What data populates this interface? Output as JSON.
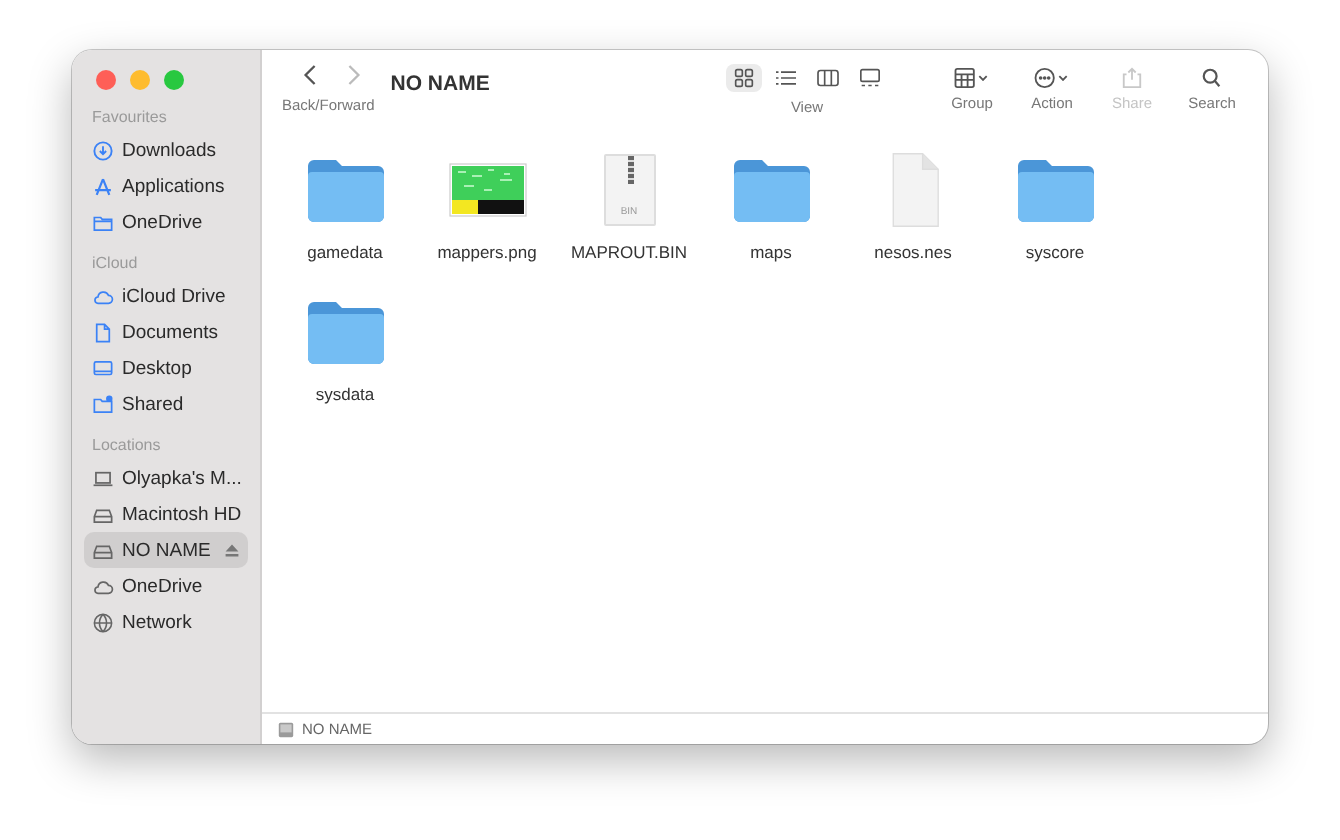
{
  "window": {
    "title": "NO NAME"
  },
  "toolbar": {
    "nav_label": "Back/Forward",
    "view_buttons": [
      {
        "kind": "icons",
        "selected": true
      },
      {
        "kind": "list",
        "selected": false
      },
      {
        "kind": "columns",
        "selected": false
      },
      {
        "kind": "gallery",
        "selected": false
      }
    ],
    "view_label": "View",
    "actions": [
      {
        "kind": "group",
        "label": "Group",
        "disabled": false
      },
      {
        "kind": "action",
        "label": "Action",
        "disabled": false
      },
      {
        "kind": "share",
        "label": "Share",
        "disabled": true
      },
      {
        "kind": "search",
        "label": "Search",
        "disabled": false
      }
    ]
  },
  "sidebar": {
    "sections": [
      {
        "title": "Favourites",
        "items": [
          {
            "kind": "download",
            "label": "Downloads",
            "selected": false,
            "ejectable": false
          },
          {
            "kind": "apps",
            "label": "Applications",
            "selected": false,
            "ejectable": false
          },
          {
            "kind": "folder",
            "label": "OneDrive",
            "selected": false,
            "ejectable": false
          }
        ]
      },
      {
        "title": "iCloud",
        "items": [
          {
            "kind": "cloud",
            "label": "iCloud Drive",
            "selected": false,
            "ejectable": false
          },
          {
            "kind": "doc",
            "label": "Documents",
            "selected": false,
            "ejectable": false
          },
          {
            "kind": "desktop",
            "label": "Desktop",
            "selected": false,
            "ejectable": false
          },
          {
            "kind": "shared",
            "label": "Shared",
            "selected": false,
            "ejectable": false
          }
        ]
      },
      {
        "title": "Locations",
        "items": [
          {
            "kind": "laptop",
            "label": "Olyapka's M...",
            "selected": false,
            "ejectable": false
          },
          {
            "kind": "drive",
            "label": "Macintosh HD",
            "selected": false,
            "ejectable": false
          },
          {
            "kind": "drive",
            "label": "NO NAME",
            "selected": true,
            "ejectable": true
          },
          {
            "kind": "cloud",
            "label": "OneDrive",
            "selected": false,
            "ejectable": false
          },
          {
            "kind": "globe",
            "label": "Network",
            "selected": false,
            "ejectable": false
          }
        ]
      }
    ]
  },
  "files": [
    {
      "kind": "folder",
      "name": "gamedata"
    },
    {
      "kind": "image",
      "name": "mappers.png"
    },
    {
      "kind": "archive",
      "name": "MAPROUT.BIN",
      "badge": "BIN"
    },
    {
      "kind": "folder",
      "name": "maps"
    },
    {
      "kind": "document",
      "name": "nesos.nes"
    },
    {
      "kind": "folder",
      "name": "syscore"
    },
    {
      "kind": "folder",
      "name": "sysdata"
    }
  ],
  "status_bar": {
    "path": "NO NAME"
  }
}
